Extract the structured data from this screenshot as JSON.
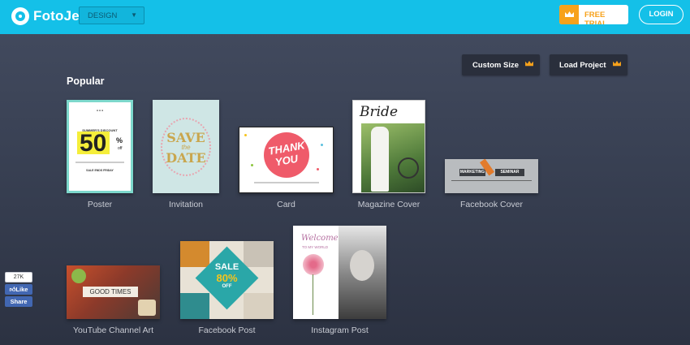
{
  "header": {
    "logo_text": "FotoJet",
    "design_select": "DESIGN",
    "free_trial": "FREE TRIAL",
    "login": "LOGIN",
    "brand_color": "#14c0e8",
    "accent_color": "#f7a21b"
  },
  "actions": {
    "custom_size": "Custom Size",
    "load_project": "Load Project"
  },
  "section_title": "Popular",
  "templates": [
    {
      "label": "Poster",
      "text": [
        "SUMMER'S DISCOUNT",
        "50",
        "%",
        "off",
        "SALE ENDS FRIDAY"
      ]
    },
    {
      "label": "Invitation",
      "text": [
        "SAVE",
        "the",
        "DATE"
      ]
    },
    {
      "label": "Card",
      "text": [
        "THANK",
        "YOU"
      ]
    },
    {
      "label": "Magazine Cover",
      "text": [
        "Bride"
      ]
    },
    {
      "label": "Facebook Cover",
      "text": [
        "MARKETING",
        "SEMINAR"
      ]
    },
    {
      "label": "YouTube Channel Art",
      "text": [
        "GOOD TIMES"
      ]
    },
    {
      "label": "Facebook Post",
      "text": [
        "SALE",
        "80%",
        "OFF"
      ]
    },
    {
      "label": "Instagram Post",
      "text": [
        "Welcome",
        "TO MY WORLD"
      ]
    }
  ],
  "social": {
    "like_count": "27K",
    "like": "Like",
    "share": "Share"
  },
  "icons": [
    "logo-icon",
    "chevron-down-icon",
    "crown-icon",
    "thumbs-up-icon"
  ]
}
